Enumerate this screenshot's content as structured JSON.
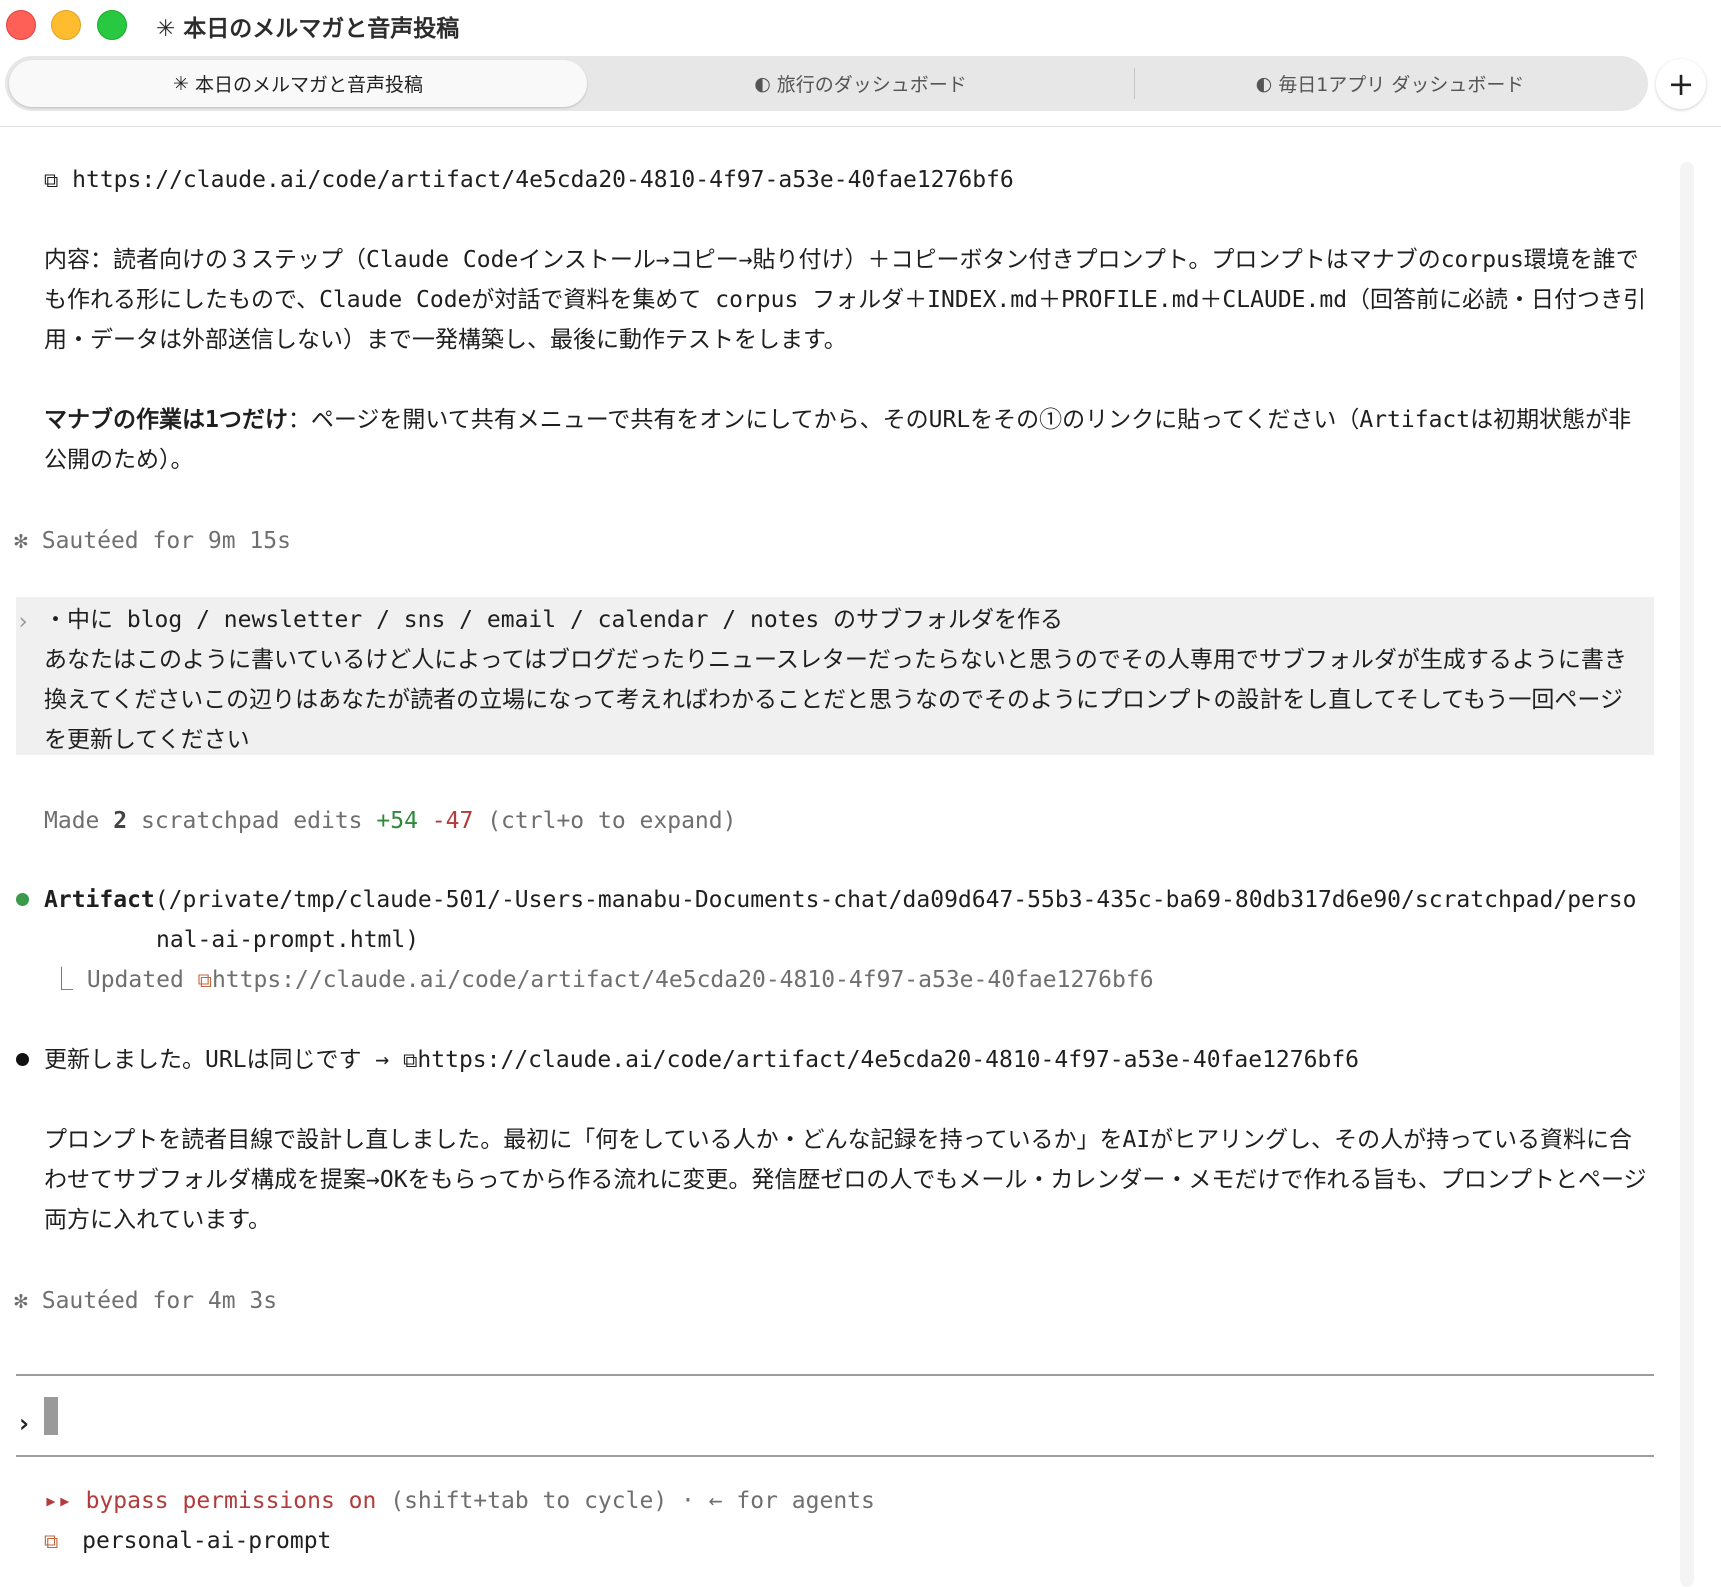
{
  "window": {
    "title": "✳ 本日のメルマガと音声投稿"
  },
  "tabs": [
    {
      "icon": "✳",
      "label": "本日のメルマガと音声投稿",
      "active": true
    },
    {
      "icon": "◐",
      "label": "旅行のダッシュボード",
      "active": false
    },
    {
      "icon": "◐",
      "label": "毎日1アプリ ダッシュボード",
      "active": false
    }
  ],
  "new_tab_label": "+",
  "transcript": {
    "top_link": "https://claude.ai/code/artifact/4e5cda20-4810-4f97-a53e-40fae1276bf6",
    "para_content": "内容：読者向けの３ステップ（Claude Codeインストール→コピー→貼り付け）＋コピーボタン付きプロンプト。プロンプトはマナブのcorpus環境を誰でも作れる形にしたもので、Claude Codeが対話で資料を集めて corpus フォルダ＋INDEX.md＋PROFILE.md＋CLAUDE.md（回答前に必読・日付つき引用・データは外部送信しない）まで一発構築し、最後に動作テストをします。",
    "para_task_bold": "マナブの作業は1つだけ",
    "para_task_rest": "：ページを開いて共有メニューで共有をオンにしてから、そのURLをその①のリンクに貼ってください（Artifactは初期状態が非公開のため）。",
    "status1_icon": "✻",
    "status1": "Sautéed for 9m 15s",
    "user_chevron": "›",
    "user_message": "・中に blog / newsletter / sns / email / calendar / notes のサブフォルダを作る\nあなたはこのように書いているけど人によってはブログだったりニュースレターだったらないと思うのでその人専用でサブフォルダが生成するように書き換えてくださいこの辺りはあなたが読者の立場になって考えればわかることだと思うなのでそのようにプロンプトの設計をし直してそしてもう一回ページを更新してください",
    "edits": {
      "made": "Made",
      "count": "2",
      "label": "scratchpad edits",
      "added": "+54",
      "removed": "-47",
      "hint": "(ctrl+o to expand)"
    },
    "tool": {
      "name": "Artifact",
      "path_line1": "(/private/tmp/claude-501/-Users-manabu-Documents-chat/da09d647-55b3-435c-ba69-80db317d6e90/scratchpad/perso",
      "path_line2": "nal-ai-prompt.html)",
      "result_branch": "⎿",
      "result_label": "Updated",
      "result_link": "https://claude.ai/code/artifact/4e5cda20-4810-4f97-a53e-40fae1276bf6"
    },
    "reply_lead": "更新しました。URLは同じです",
    "reply_arrow": "→",
    "reply_link": "https://claude.ai/code/artifact/4e5cda20-4810-4f97-a53e-40fae1276bf6",
    "reply_body": "プロンプトを読者目線で設計し直しました。最初に「何をしている人か・どんな記録を持っているか」をAIがヒアリングし、その人が持っている資料に合わせてサブフォルダ構成を提案→OKをもらってから作る流れに変更。発信歴ゼロの人でもメール・カレンダー・メモだけで作れる旨も、プロンプトとページ両方に入れています。",
    "status2_icon": "✻",
    "status2": "Sautéed for 4m 3s"
  },
  "input": {
    "prompt_symbol": "›"
  },
  "footer": {
    "mode_icon": "▸▸",
    "mode_text": "bypass permissions on",
    "mode_hint": "(shift+tab to cycle) · ← for agents",
    "project_name": "personal-ai-prompt"
  },
  "colors": {
    "accent_green": "#2e8b3a",
    "accent_red": "#b23b3b",
    "brand_orange": "#c2673f"
  }
}
